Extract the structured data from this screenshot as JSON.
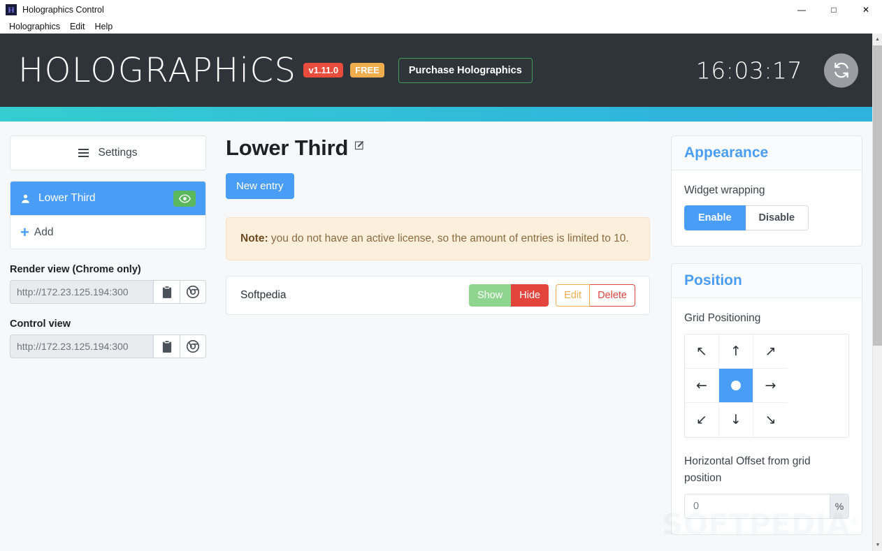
{
  "window": {
    "title": "Holographics Control",
    "icon": "H",
    "controls": {
      "minimize": "—",
      "maximize": "□",
      "close": "✕"
    }
  },
  "menubar": {
    "items": [
      {
        "label": "Holographics"
      },
      {
        "label": "Edit"
      },
      {
        "label": "Help"
      }
    ]
  },
  "header": {
    "logo": "HOLOGRAPHiCS",
    "version_badge": "v1.11.0",
    "license_badge": "FREE",
    "purchase_button": "Purchase Holographics",
    "clock": "16:03:17",
    "refresh_icon": "refresh-icon"
  },
  "sidebar": {
    "settings_label": "Settings",
    "widgets": [
      {
        "name": "Lower Third",
        "active": true,
        "visible": true
      }
    ],
    "add_label": "Add",
    "render_view": {
      "label": "Render view (Chrome only)",
      "url": "http://172.23.125.194:300",
      "copy_icon": "clipboard-icon",
      "open_icon": "chrome-icon"
    },
    "control_view": {
      "label": "Control view",
      "url": "http://172.23.125.194:300",
      "copy_icon": "clipboard-icon",
      "open_icon": "chrome-icon"
    }
  },
  "main": {
    "page_title": "Lower Third",
    "edit_icon": "edit-pencil-icon",
    "new_entry_label": "New entry",
    "note": {
      "prefix": "Note:",
      "text": " you do not have an active license, so the amount of entries is limited to 10."
    },
    "entries": [
      {
        "name": "Softpedia",
        "show_label": "Show",
        "hide_label": "Hide",
        "edit_label": "Edit",
        "delete_label": "Delete"
      }
    ]
  },
  "appearance": {
    "title": "Appearance",
    "widget_wrapping_label": "Widget wrapping",
    "enable_label": "Enable",
    "disable_label": "Disable",
    "selected": "Enable"
  },
  "position": {
    "title": "Position",
    "grid_label": "Grid Positioning",
    "grid_cells": [
      {
        "name": "top-left",
        "glyph": "↖"
      },
      {
        "name": "top-center",
        "glyph": "↑"
      },
      {
        "name": "top-right",
        "glyph": "↗"
      },
      {
        "name": "middle-left",
        "glyph": "←"
      },
      {
        "name": "center",
        "glyph": ""
      },
      {
        "name": "middle-right",
        "glyph": "→"
      },
      {
        "name": "bottom-left",
        "glyph": "↙"
      },
      {
        "name": "bottom-center",
        "glyph": "↓"
      },
      {
        "name": "bottom-right",
        "glyph": "↘"
      }
    ],
    "selected_cell": "center",
    "offset_label": "Horizontal Offset from grid position",
    "offset_value": "0",
    "offset_unit": "%"
  },
  "watermark": "SOFTPEDIA",
  "colors": {
    "accent_blue": "#4a9df5",
    "header_dark": "#2f343b",
    "teal": "#35cdd0",
    "green": "#5cb85c",
    "red": "#e3453d",
    "orange": "#f0ad4e"
  }
}
